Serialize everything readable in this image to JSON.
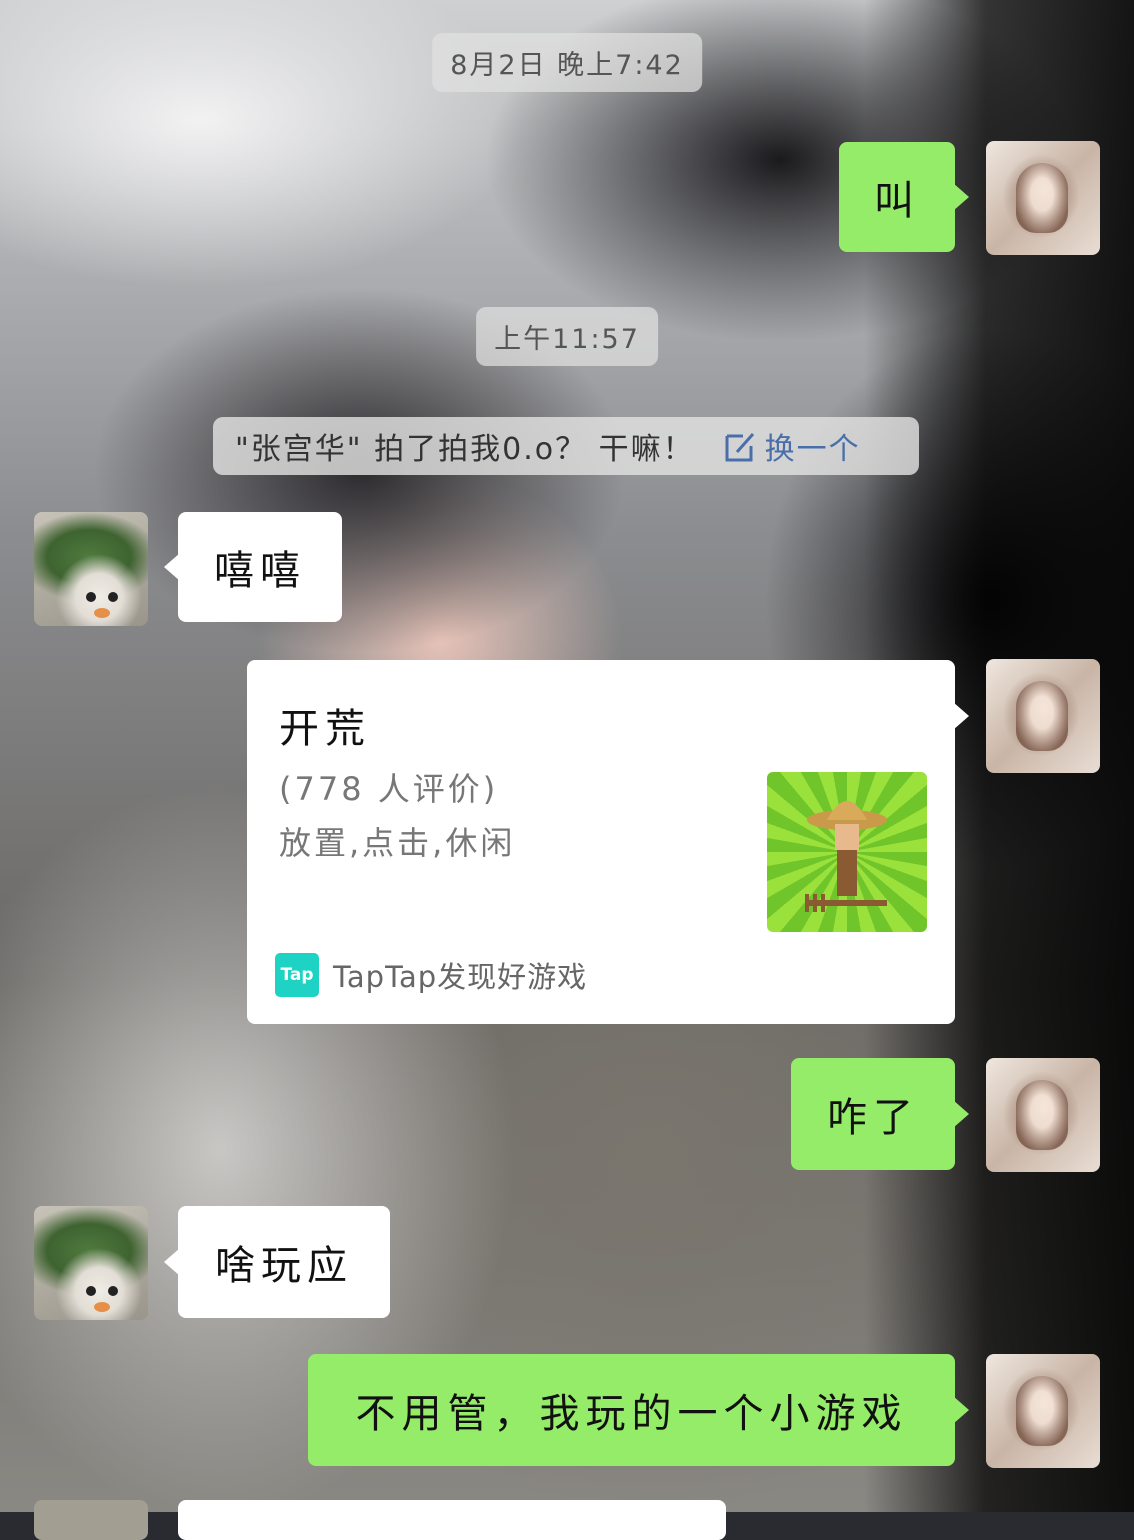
{
  "timestamps": [
    "8月2日 晚上7:42",
    "上午11:57"
  ],
  "system_notice": {
    "text": "\"张宫华\" 拍了拍我0.o？ 干嘛！",
    "action_label": "换一个",
    "icon": "edit-icon"
  },
  "messages": [
    {
      "side": "right",
      "text": "叫"
    },
    {
      "side": "left",
      "text": "嘻嘻"
    },
    {
      "side": "right",
      "type": "app_card"
    },
    {
      "side": "right",
      "text": "咋了"
    },
    {
      "side": "left",
      "text": "啥玩应"
    },
    {
      "side": "right",
      "text": "不用管，我玩的一个小游戏"
    }
  ],
  "app_card": {
    "title": "开荒",
    "rating": "(778 人评价)",
    "tags": "放置,点击,休闲",
    "source": "TapTap发现好游戏",
    "source_logo": "Tap"
  },
  "colors": {
    "my_bubble": "#95ec69",
    "other_bubble": "#ffffff",
    "taptap": "#1ed3c4",
    "link_blue": "#4a6fa8"
  }
}
